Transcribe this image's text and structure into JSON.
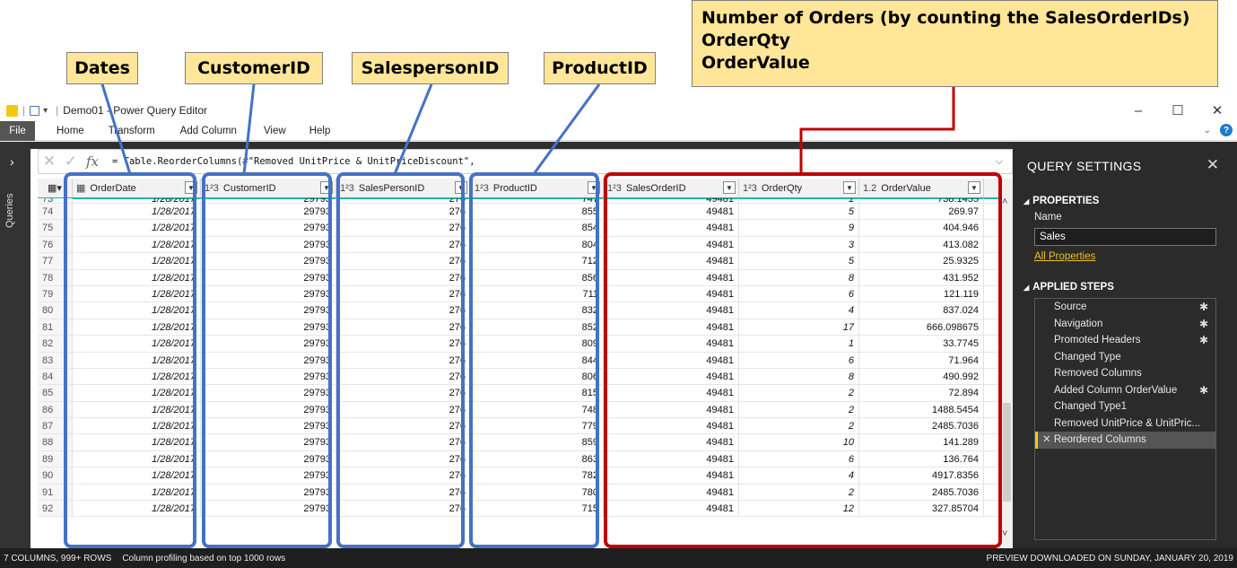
{
  "callouts": {
    "dates": "Dates",
    "customer": "CustomerID",
    "salesperson": "SalespersonID",
    "product": "ProductID",
    "measures": [
      "Number of Orders (by counting the SalesOrderIDs)",
      "OrderQty",
      "OrderValue"
    ]
  },
  "window": {
    "title": "Demo01 - Power Query Editor",
    "minimize": "–",
    "maximize": "☐",
    "close": "✕"
  },
  "ribbon": {
    "file": "File",
    "tabs": [
      "Home",
      "Transform",
      "Add Column",
      "View",
      "Help"
    ]
  },
  "queries_label": "Queries",
  "formula": {
    "cancel": "✕",
    "confirm": "✓",
    "fx": "fx",
    "text": "= Table.ReorderColumns(#\"Removed UnitPrice & UnitPriceDiscount\","
  },
  "columns": [
    {
      "type": "▦",
      "name": "OrderDate"
    },
    {
      "type": "1²3",
      "name": "CustomerID"
    },
    {
      "type": "1²3",
      "name": "SalesPersonID"
    },
    {
      "type": "1²3",
      "name": "ProductID"
    },
    {
      "type": "1²3",
      "name": "SalesOrderID"
    },
    {
      "type": "1²3",
      "name": "OrderQty"
    },
    {
      "type": "1.2",
      "name": "OrderValue"
    }
  ],
  "partial_row": [
    "73",
    "1/28/2017",
    "29793",
    "276",
    "747",
    "49481",
    "1",
    "738.1455"
  ],
  "rows": [
    [
      "74",
      "1/28/2017",
      "29793",
      "276",
      "855",
      "49481",
      "5",
      "269.97"
    ],
    [
      "75",
      "1/28/2017",
      "29793",
      "276",
      "854",
      "49481",
      "9",
      "404.946"
    ],
    [
      "76",
      "1/28/2017",
      "29793",
      "276",
      "804",
      "49481",
      "3",
      "413.082"
    ],
    [
      "77",
      "1/28/2017",
      "29793",
      "276",
      "712",
      "49481",
      "5",
      "25.9325"
    ],
    [
      "78",
      "1/28/2017",
      "29793",
      "276",
      "856",
      "49481",
      "8",
      "431.952"
    ],
    [
      "79",
      "1/28/2017",
      "29793",
      "276",
      "711",
      "49481",
      "6",
      "121.119"
    ],
    [
      "80",
      "1/28/2017",
      "29793",
      "276",
      "832",
      "49481",
      "4",
      "837.024"
    ],
    [
      "81",
      "1/28/2017",
      "29793",
      "276",
      "852",
      "49481",
      "17",
      "666.098675"
    ],
    [
      "82",
      "1/28/2017",
      "29793",
      "276",
      "809",
      "49481",
      "1",
      "33.7745"
    ],
    [
      "83",
      "1/28/2017",
      "29793",
      "276",
      "844",
      "49481",
      "6",
      "71.964"
    ],
    [
      "84",
      "1/28/2017",
      "29793",
      "276",
      "806",
      "49481",
      "8",
      "490.992"
    ],
    [
      "85",
      "1/28/2017",
      "29793",
      "276",
      "815",
      "49481",
      "2",
      "72.894"
    ],
    [
      "86",
      "1/28/2017",
      "29793",
      "276",
      "748",
      "49481",
      "2",
      "1488.5454"
    ],
    [
      "87",
      "1/28/2017",
      "29793",
      "276",
      "779",
      "49481",
      "2",
      "2485.7036"
    ],
    [
      "88",
      "1/28/2017",
      "29793",
      "276",
      "859",
      "49481",
      "10",
      "141.289"
    ],
    [
      "89",
      "1/28/2017",
      "29793",
      "276",
      "863",
      "49481",
      "6",
      "136.764"
    ],
    [
      "90",
      "1/28/2017",
      "29793",
      "276",
      "782",
      "49481",
      "4",
      "4917.8356"
    ],
    [
      "91",
      "1/28/2017",
      "29793",
      "276",
      "780",
      "49481",
      "2",
      "2485.7036"
    ],
    [
      "92",
      "1/28/2017",
      "29793",
      "276",
      "715",
      "49481",
      "12",
      "327.85704"
    ]
  ],
  "settings": {
    "title": "QUERY SETTINGS",
    "close": "✕",
    "properties": "PROPERTIES",
    "name_label": "Name",
    "name_value": "Sales",
    "all_properties": "All Properties",
    "applied_steps": "APPLIED STEPS",
    "steps": [
      {
        "label": "Source",
        "gear": true
      },
      {
        "label": "Navigation",
        "gear": true
      },
      {
        "label": "Promoted Headers",
        "gear": true
      },
      {
        "label": "Changed Type",
        "gear": false
      },
      {
        "label": "Removed Columns",
        "gear": false
      },
      {
        "label": "Added Column OrderValue",
        "gear": true
      },
      {
        "label": "Changed Type1",
        "gear": false
      },
      {
        "label": "Removed UnitPrice & UnitPric...",
        "gear": false
      },
      {
        "label": "Reordered Columns",
        "gear": false,
        "selected": true
      }
    ]
  },
  "status": {
    "columns_rows": "7 COLUMNS, 999+ ROWS",
    "profiling": "Column profiling based on top 1000 rows",
    "preview": "PREVIEW DOWNLOADED ON SUNDAY, JANUARY 20, 2019"
  },
  "colors": {
    "callout_fill": "#ffe699",
    "blue_highlight": "#4472c4",
    "red_highlight": "#c00000",
    "accent_teal": "#1fb6a8",
    "pbi_yellow": "#f2c811"
  }
}
